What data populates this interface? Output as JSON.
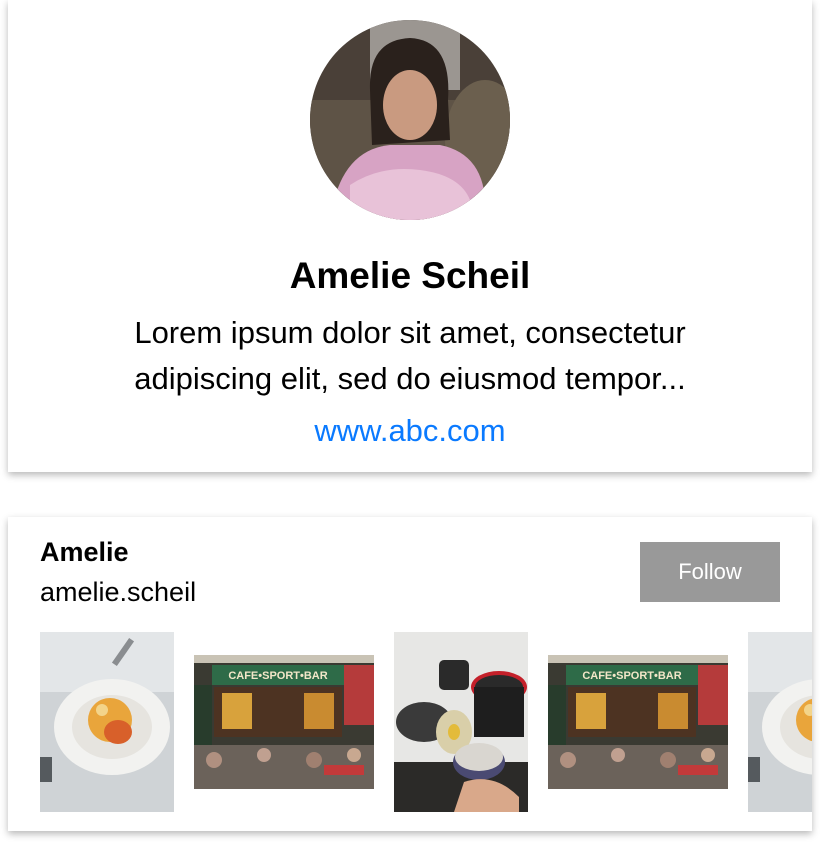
{
  "profile": {
    "name": "Amelie Scheil",
    "bio": "Lorem ipsum dolor sit amet, consectetur adipiscing elit, sed do eiusmod tempor...",
    "website": "www.abc.com",
    "avatar_icon": "profile-photo",
    "link_color": "#0a7aff"
  },
  "feed": {
    "display_name": "Amelie",
    "username": "amelie.scheil",
    "follow_label": "Follow",
    "follow_color": "#999999",
    "photos": [
      {
        "subject": "dessert-plate",
        "sign_text": ""
      },
      {
        "subject": "cafe-storefront",
        "sign_text": "CAFE•SPORT•BAR"
      },
      {
        "subject": "camera-gear",
        "sign_text": ""
      },
      {
        "subject": "cafe-storefront",
        "sign_text": "CAFE•SPORT•BAR"
      },
      {
        "subject": "dessert-plate",
        "sign_text": ""
      }
    ]
  }
}
